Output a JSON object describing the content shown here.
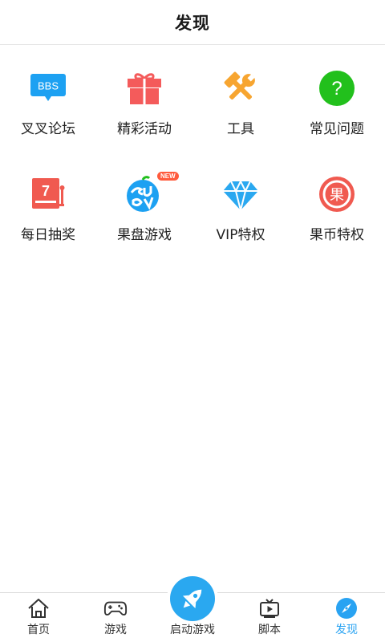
{
  "header": {
    "title": "发现"
  },
  "grid": {
    "items": [
      {
        "label": "叉叉论坛",
        "icon": "bbs-chat-icon",
        "icon_text": "BBS",
        "color": "#1da1f2"
      },
      {
        "label": "精彩活动",
        "icon": "gift-icon",
        "color": "#f45b5b"
      },
      {
        "label": "工具",
        "icon": "tools-icon",
        "color": "#f7a530"
      },
      {
        "label": "常见问题",
        "icon": "question-icon",
        "icon_text": "?",
        "color": "#22c01c"
      },
      {
        "label": "每日抽奖",
        "icon": "slot-machine-icon",
        "icon_text": "7",
        "color": "#f05a50"
      },
      {
        "label": "果盘游戏",
        "icon": "guopan-logo-icon",
        "badge": "NEW",
        "color": "#1da1f2"
      },
      {
        "label": "VIP特权",
        "icon": "diamond-icon",
        "color": "#2aa8f0"
      },
      {
        "label": "果币特权",
        "icon": "guobi-coin-icon",
        "icon_text": "果",
        "color": "#f05a50"
      }
    ]
  },
  "tabbar": {
    "tabs": [
      {
        "label": "首页",
        "icon": "home-icon"
      },
      {
        "label": "游戏",
        "icon": "gamepad-icon"
      },
      {
        "label": "启动游戏",
        "icon": "rocket-icon"
      },
      {
        "label": "脚本",
        "icon": "script-tv-icon"
      },
      {
        "label": "发现",
        "icon": "compass-icon",
        "active": true
      }
    ],
    "active_color": "#29a3f2"
  }
}
